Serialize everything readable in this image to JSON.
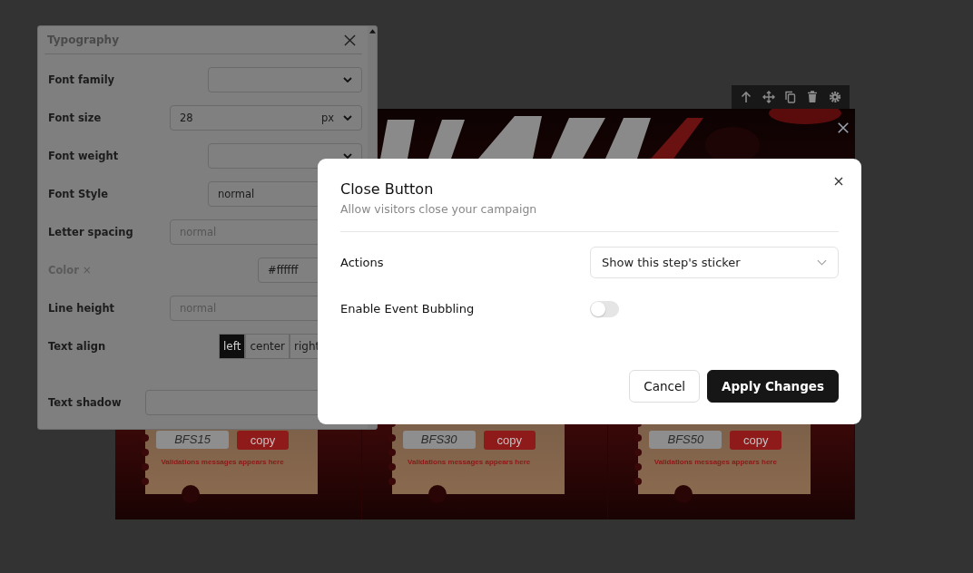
{
  "toolbar": {
    "tools": [
      {
        "kind": "up"
      },
      {
        "kind": "move"
      },
      {
        "kind": "copy"
      },
      {
        "kind": "delete"
      },
      {
        "kind": "settings"
      }
    ]
  },
  "campaign": {
    "coupons": [
      {
        "code": "BFS15",
        "button": "copy",
        "message": "Validations messages appears here"
      },
      {
        "code": "BFS30",
        "button": "copy",
        "message": "Validations messages appears here"
      },
      {
        "code": "BFS50",
        "button": "copy",
        "message": "Validations messages appears here"
      }
    ]
  },
  "typography_panel": {
    "title": "Typography",
    "rows": [
      {
        "kind": "select",
        "label": "Font family"
      },
      {
        "kind": "unit",
        "label": "Font size",
        "value": "28",
        "unit": "px"
      },
      {
        "kind": "select",
        "label": "Font weight"
      },
      {
        "kind": "input",
        "label": "Font Style",
        "value": "normal"
      },
      {
        "kind": "input",
        "label": "Letter spacing",
        "placeholder": "normal"
      },
      {
        "kind": "color",
        "label": "Color",
        "clear": "×",
        "disabled": true,
        "value": "#ffffff"
      },
      {
        "kind": "input",
        "label": "Line height",
        "placeholder": "normal"
      },
      {
        "kind": "segments",
        "label": "Text align",
        "options": [
          {
            "label": "left",
            "selected": true
          },
          {
            "label": "center",
            "selected": false
          },
          {
            "label": "right",
            "selected": false
          }
        ]
      },
      {
        "kind": "input",
        "label": "Text shadow"
      }
    ]
  },
  "dialog": {
    "title": "Close Button",
    "subtitle": "Allow visitors close your campaign",
    "fields": [
      {
        "kind": "select",
        "label": "Actions",
        "value": "Show this step's sticker"
      },
      {
        "kind": "toggle",
        "label": "Enable Event Bubbling",
        "on": false
      }
    ],
    "buttons": [
      {
        "kind": "secondary",
        "label": "Cancel"
      },
      {
        "kind": "primary",
        "label": "Apply Changes"
      }
    ]
  }
}
